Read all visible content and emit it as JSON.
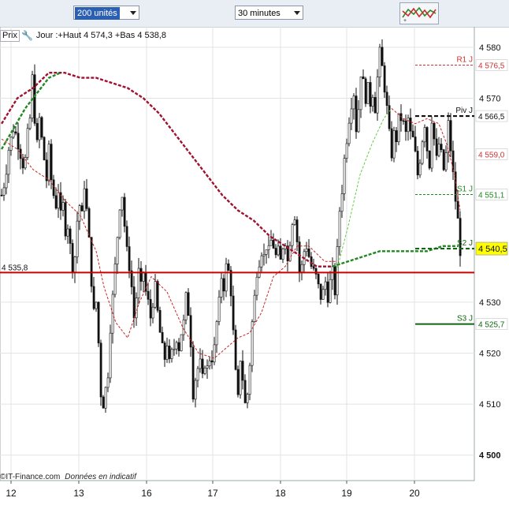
{
  "toolbar": {
    "units_value": "200 unités",
    "interval_value": "30 minutes",
    "indicator_icon": "indicators-icon"
  },
  "legend": {
    "prix_label": "Prix",
    "wrench_icon": "wrench-icon",
    "summary": "Jour :+Haut 4 574,3 +Bas 4 538,8"
  },
  "footer": {
    "copyright": "©IT-Finance.com",
    "note": "Données en indicatif"
  },
  "colors": {
    "candle": "#111111",
    "hline_red": "#cc0000",
    "sma_fast": "#cc2222",
    "sma_slow_down": "#a01030",
    "sma_up": "#228822",
    "pivot_r1": "#cc3333",
    "pivot_piv": "#111111",
    "pivot_s1": "#228822",
    "pivot_s2": "#116611",
    "price_tag_bg": "#ffff00",
    "grid": "#e3e3e3"
  },
  "chart_data": {
    "type": "candlestick",
    "instrument_note": "30 minutes, 200 unités",
    "y_range": [
      4495,
      4584
    ],
    "y_ticks": [
      {
        "label": "4 580",
        "value": 4580
      },
      {
        "label": "4 570",
        "value": 4570
      },
      {
        "label": "4 530",
        "value": 4530
      },
      {
        "label": "4 520",
        "value": 4520
      },
      {
        "label": "4 510",
        "value": 4510
      },
      {
        "label": "4 500",
        "value": 4500,
        "bold": true
      }
    ],
    "x_ticks": [
      "12",
      "13",
      "16",
      "17",
      "18",
      "19",
      "20"
    ],
    "horizontal_line": {
      "label": "4 535,8",
      "value": 4535.8
    },
    "pivots": [
      {
        "name": "R1 J",
        "value": 4576.5,
        "label": "4 576,5",
        "style": "dashed"
      },
      {
        "name": "Piv J",
        "value": 4566.5,
        "label": "4 566,5",
        "style": "dashed"
      },
      {
        "name": "S1 J",
        "value": 4551.1,
        "label": "4 551,1",
        "style": "dashed"
      },
      {
        "name": "S2 J",
        "value": 4540.5,
        "label": "4 540,5",
        "style": "dashed"
      },
      {
        "name": "S3 J",
        "value": 4525.7,
        "label": "4 525,7",
        "style": "solid"
      }
    ],
    "extra_labels": [
      {
        "value": 4559.0,
        "label": "4 559,0"
      }
    ],
    "last_price": {
      "value": 4540.5,
      "label": "4 540,5"
    },
    "close_path": [
      [
        0,
        4551
      ],
      [
        3,
        4553
      ],
      [
        6,
        4556
      ],
      [
        9,
        4560
      ],
      [
        12,
        4562
      ],
      [
        15,
        4564
      ],
      [
        18,
        4563
      ],
      [
        21,
        4561
      ],
      [
        24,
        4559
      ],
      [
        27,
        4557
      ],
      [
        30,
        4558
      ],
      [
        33,
        4563
      ],
      [
        36,
        4566
      ],
      [
        39,
        4574
      ],
      [
        42,
        4566
      ],
      [
        45,
        4561
      ],
      [
        48,
        4566
      ],
      [
        51,
        4562
      ],
      [
        54,
        4558
      ],
      [
        57,
        4554
      ],
      [
        60,
        4560
      ],
      [
        63,
        4554
      ],
      [
        66,
        4551
      ],
      [
        69,
        4549
      ],
      [
        72,
        4552
      ],
      [
        75,
        4547
      ],
      [
        78,
        4549
      ],
      [
        81,
        4544
      ],
      [
        84,
        4545
      ],
      [
        87,
        4541
      ],
      [
        90,
        4537
      ],
      [
        93,
        4539
      ],
      [
        96,
        4546
      ],
      [
        99,
        4549
      ],
      [
        102,
        4547
      ],
      [
        105,
        4553
      ],
      [
        108,
        4548
      ],
      [
        111,
        4542
      ],
      [
        114,
        4534
      ],
      [
        117,
        4528
      ],
      [
        120,
        4530
      ],
      [
        123,
        4522
      ],
      [
        126,
        4512
      ],
      [
        129,
        4510
      ],
      [
        132,
        4513
      ],
      [
        135,
        4516
      ],
      [
        138,
        4525
      ],
      [
        141,
        4531
      ],
      [
        144,
        4537
      ],
      [
        147,
        4543
      ],
      [
        150,
        4549
      ],
      [
        153,
        4551
      ],
      [
        156,
        4545
      ],
      [
        159,
        4540
      ],
      [
        162,
        4537
      ],
      [
        165,
        4533
      ],
      [
        168,
        4527
      ],
      [
        171,
        4531
      ],
      [
        174,
        4536
      ],
      [
        177,
        4533
      ],
      [
        180,
        4536
      ],
      [
        183,
        4532
      ],
      [
        186,
        4530
      ],
      [
        189,
        4527
      ],
      [
        192,
        4530
      ],
      [
        195,
        4533
      ],
      [
        198,
        4528
      ],
      [
        201,
        4524
      ],
      [
        204,
        4521
      ],
      [
        207,
        4519
      ],
      [
        210,
        4522
      ],
      [
        213,
        4518
      ],
      [
        216,
        4520
      ],
      [
        219,
        4521
      ],
      [
        222,
        4523
      ],
      [
        225,
        4521
      ],
      [
        228,
        4524
      ],
      [
        231,
        4526
      ],
      [
        234,
        4531
      ],
      [
        237,
        4528
      ],
      [
        240,
        4522
      ],
      [
        243,
        4512
      ],
      [
        246,
        4515
      ],
      [
        249,
        4517
      ],
      [
        252,
        4518
      ],
      [
        255,
        4515
      ],
      [
        258,
        4518
      ],
      [
        261,
        4517
      ],
      [
        264,
        4519
      ],
      [
        267,
        4519
      ],
      [
        270,
        4521
      ],
      [
        273,
        4526
      ],
      [
        276,
        4530
      ],
      [
        279,
        4535
      ],
      [
        282,
        4533
      ],
      [
        285,
        4537
      ],
      [
        288,
        4536
      ],
      [
        291,
        4532
      ],
      [
        294,
        4524
      ],
      [
        297,
        4516
      ],
      [
        300,
        4511
      ],
      [
        303,
        4519
      ],
      [
        306,
        4515
      ],
      [
        309,
        4510
      ],
      [
        312,
        4512
      ],
      [
        315,
        4518
      ],
      [
        318,
        4526
      ],
      [
        321,
        4531
      ],
      [
        324,
        4536
      ],
      [
        327,
        4538
      ],
      [
        330,
        4540
      ],
      [
        333,
        4539
      ],
      [
        336,
        4541
      ],
      [
        339,
        4540
      ],
      [
        342,
        4542
      ],
      [
        345,
        4541
      ],
      [
        348,
        4539
      ],
      [
        351,
        4540
      ],
      [
        354,
        4538
      ],
      [
        357,
        4541
      ],
      [
        360,
        4542
      ],
      [
        363,
        4538
      ],
      [
        366,
        4542
      ],
      [
        369,
        4546
      ],
      [
        372,
        4547
      ],
      [
        375,
        4542
      ],
      [
        378,
        4536
      ],
      [
        381,
        4537
      ],
      [
        384,
        4540
      ],
      [
        387,
        4541
      ],
      [
        390,
        4539
      ],
      [
        393,
        4537
      ],
      [
        396,
        4536
      ],
      [
        399,
        4535
      ],
      [
        402,
        4533
      ],
      [
        405,
        4531
      ],
      [
        408,
        4532
      ],
      [
        411,
        4534
      ],
      [
        414,
        4531
      ],
      [
        417,
        4534
      ],
      [
        420,
        4536
      ],
      [
        423,
        4532
      ],
      [
        426,
        4540
      ],
      [
        429,
        4548
      ],
      [
        432,
        4552
      ],
      [
        435,
        4558
      ],
      [
        438,
        4562
      ],
      [
        441,
        4566
      ],
      [
        444,
        4569
      ],
      [
        447,
        4571
      ],
      [
        450,
        4564
      ],
      [
        453,
        4568
      ],
      [
        456,
        4575
      ],
      [
        459,
        4573
      ],
      [
        462,
        4570
      ],
      [
        465,
        4572
      ],
      [
        468,
        4569
      ],
      [
        471,
        4571
      ],
      [
        474,
        4568
      ],
      [
        477,
        4574
      ],
      [
        480,
        4579
      ],
      [
        483,
        4576
      ],
      [
        486,
        4572
      ],
      [
        489,
        4568
      ],
      [
        492,
        4563
      ],
      [
        495,
        4559
      ],
      [
        498,
        4563
      ],
      [
        501,
        4562
      ],
      [
        504,
        4566
      ],
      [
        507,
        4566
      ],
      [
        510,
        4565
      ],
      [
        513,
        4563
      ],
      [
        516,
        4566
      ],
      [
        519,
        4563
      ],
      [
        522,
        4562
      ],
      [
        525,
        4559
      ],
      [
        528,
        4555
      ],
      [
        531,
        4558
      ],
      [
        534,
        4562
      ],
      [
        537,
        4565
      ],
      [
        540,
        4560
      ],
      [
        543,
        4557
      ],
      [
        546,
        4566
      ],
      [
        549,
        4562
      ],
      [
        552,
        4558
      ],
      [
        555,
        4561
      ],
      [
        558,
        4559
      ],
      [
        561,
        4556
      ],
      [
        564,
        4559
      ],
      [
        567,
        4565
      ],
      [
        570,
        4560
      ],
      [
        573,
        4555
      ],
      [
        576,
        4550
      ],
      [
        579,
        4546
      ],
      [
        582,
        4540
      ],
      [
        583,
        4540.5
      ]
    ],
    "sma_fast": [
      [
        0,
        4562
      ],
      [
        20,
        4560
      ],
      [
        40,
        4556
      ],
      [
        60,
        4554
      ],
      [
        80,
        4550
      ],
      [
        100,
        4547
      ],
      [
        120,
        4540
      ],
      [
        130,
        4533
      ],
      [
        145,
        4526
      ],
      [
        160,
        4523
      ],
      [
        175,
        4530
      ],
      [
        190,
        4535
      ],
      [
        210,
        4532
      ],
      [
        230,
        4525
      ],
      [
        250,
        4520
      ],
      [
        270,
        4519
      ],
      [
        285,
        4521
      ],
      [
        300,
        4523
      ],
      [
        315,
        4524
      ],
      [
        330,
        4528
      ],
      [
        345,
        4535
      ],
      [
        360,
        4537
      ],
      [
        375,
        4541
      ],
      [
        390,
        4541
      ],
      [
        410,
        4538
      ],
      [
        425,
        4538
      ]
    ],
    "sma_up": [
      [
        425,
        4536
      ],
      [
        440,
        4545
      ],
      [
        455,
        4555
      ],
      [
        470,
        4561
      ],
      [
        485,
        4566
      ],
      [
        495,
        4568
      ]
    ],
    "sma_fast2": [
      [
        495,
        4568
      ],
      [
        510,
        4566
      ],
      [
        525,
        4565
      ],
      [
        540,
        4566
      ],
      [
        555,
        4565
      ],
      [
        565,
        4561
      ],
      [
        575,
        4555
      ],
      [
        582,
        4548
      ]
    ],
    "sma_slow": [
      [
        0,
        4565
      ],
      [
        20,
        4570
      ],
      [
        40,
        4572
      ],
      [
        60,
        4575
      ],
      [
        80,
        4575
      ],
      [
        100,
        4574
      ],
      [
        120,
        4574
      ],
      [
        140,
        4573
      ],
      [
        160,
        4572
      ],
      [
        180,
        4570
      ],
      [
        200,
        4567
      ],
      [
        220,
        4563
      ],
      [
        240,
        4559
      ],
      [
        260,
        4555
      ],
      [
        280,
        4551
      ],
      [
        300,
        4548
      ],
      [
        320,
        4546
      ],
      [
        340,
        4543
      ],
      [
        360,
        4541
      ],
      [
        380,
        4539
      ],
      [
        400,
        4537
      ],
      [
        420,
        4537
      ]
    ],
    "sma_slow_up": [
      [
        420,
        4537
      ],
      [
        440,
        4538
      ],
      [
        460,
        4539
      ],
      [
        480,
        4540
      ],
      [
        500,
        4540
      ],
      [
        520,
        4540
      ],
      [
        540,
        4540
      ],
      [
        560,
        4541
      ],
      [
        580,
        4541
      ]
    ]
  }
}
